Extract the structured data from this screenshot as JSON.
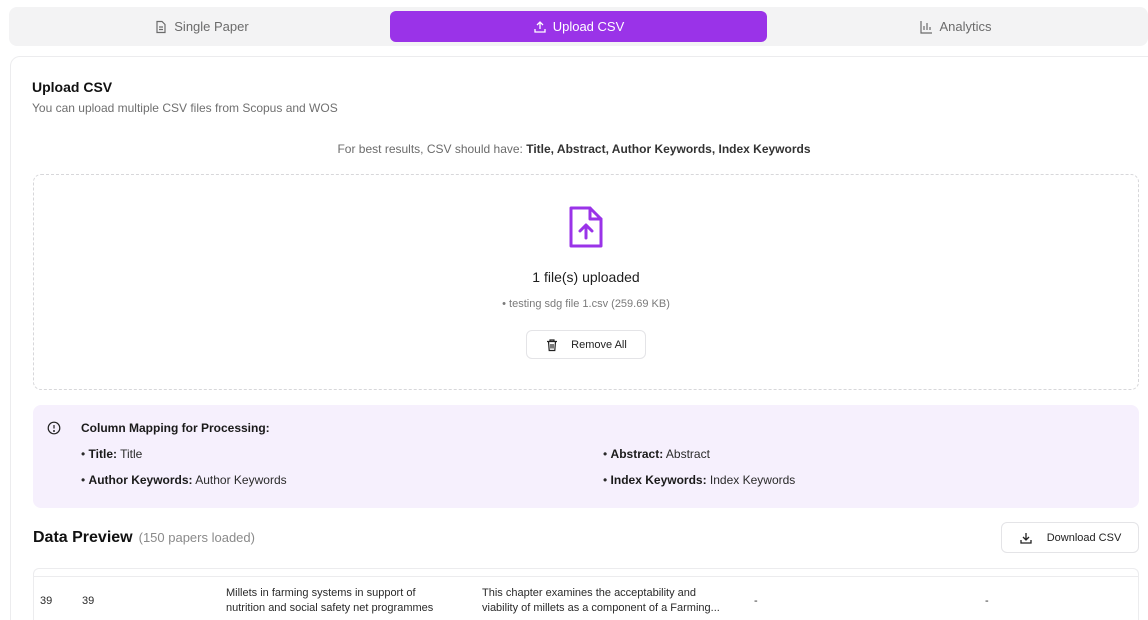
{
  "tabs": [
    {
      "label": "Single Paper",
      "icon": "document-icon",
      "active": false
    },
    {
      "label": "Upload CSV",
      "icon": "upload-icon",
      "active": true
    },
    {
      "label": "Analytics",
      "icon": "bar-chart-icon",
      "active": false
    }
  ],
  "colors": {
    "accent": "#9a33e8",
    "mapping_bg": "#f6f0fd"
  },
  "upload": {
    "heading": "Upload CSV",
    "subheading": "You can upload multiple CSV files from Scopus and WOS",
    "hint_prefix": "For best results, CSV should have: ",
    "hint_fields": "Title, Abstract, Author Keywords, Index Keywords",
    "file_count": "1 file(s) uploaded",
    "file_entry": "• testing sdg file 1.csv (259.69 KB)",
    "remove_all_label": "Remove All"
  },
  "mapping": {
    "title": "Column Mapping for Processing:",
    "items": [
      {
        "key": "Title:",
        "value": "Title"
      },
      {
        "key": "Abstract:",
        "value": "Abstract"
      },
      {
        "key": "Author Keywords:",
        "value": "Author Keywords"
      },
      {
        "key": "Index Keywords:",
        "value": "Index Keywords"
      }
    ]
  },
  "preview": {
    "title": "Data Preview",
    "count": "(150 papers loaded)",
    "download_label": "Download CSV",
    "rows": [
      {
        "c1": "39",
        "c2": "39",
        "title_line1": "Millets in farming systems in support of",
        "title_line2": "nutrition and social safety net programmes",
        "abstract_line1": "This chapter examines the acceptability and",
        "abstract_line2": "viability of millets as a component of a Farming...",
        "c5": "-",
        "c6": "-"
      }
    ]
  }
}
